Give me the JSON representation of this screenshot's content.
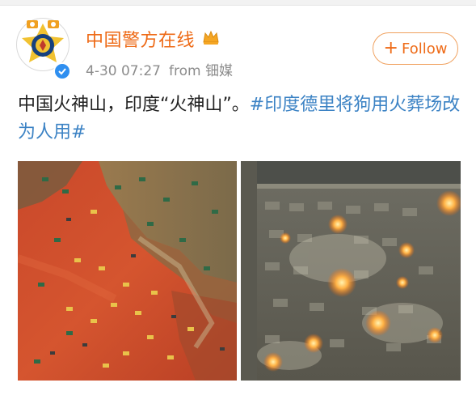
{
  "account": {
    "name": "中国警方在线",
    "time": "4-30 07:27",
    "source": "from 钿媒"
  },
  "follow_button": {
    "label": "Follow"
  },
  "post": {
    "text": "中国火神山，印度“火神山”。",
    "hashtag": "#印度德里将狗用火葬场改为人用#"
  },
  "images": [
    {
      "name": "construction-site-photo"
    },
    {
      "name": "cremation-site-photo"
    }
  ],
  "icons": {
    "avatar": "police-emblem-icon",
    "verified": "verified-badge-icon",
    "crown": "crown-icon",
    "follow": "plus-icon"
  },
  "colors": {
    "name": "#ee6a16",
    "hashtag": "#3b82c4",
    "meta": "#8c8c8c",
    "verified": "#2f8ff0"
  }
}
